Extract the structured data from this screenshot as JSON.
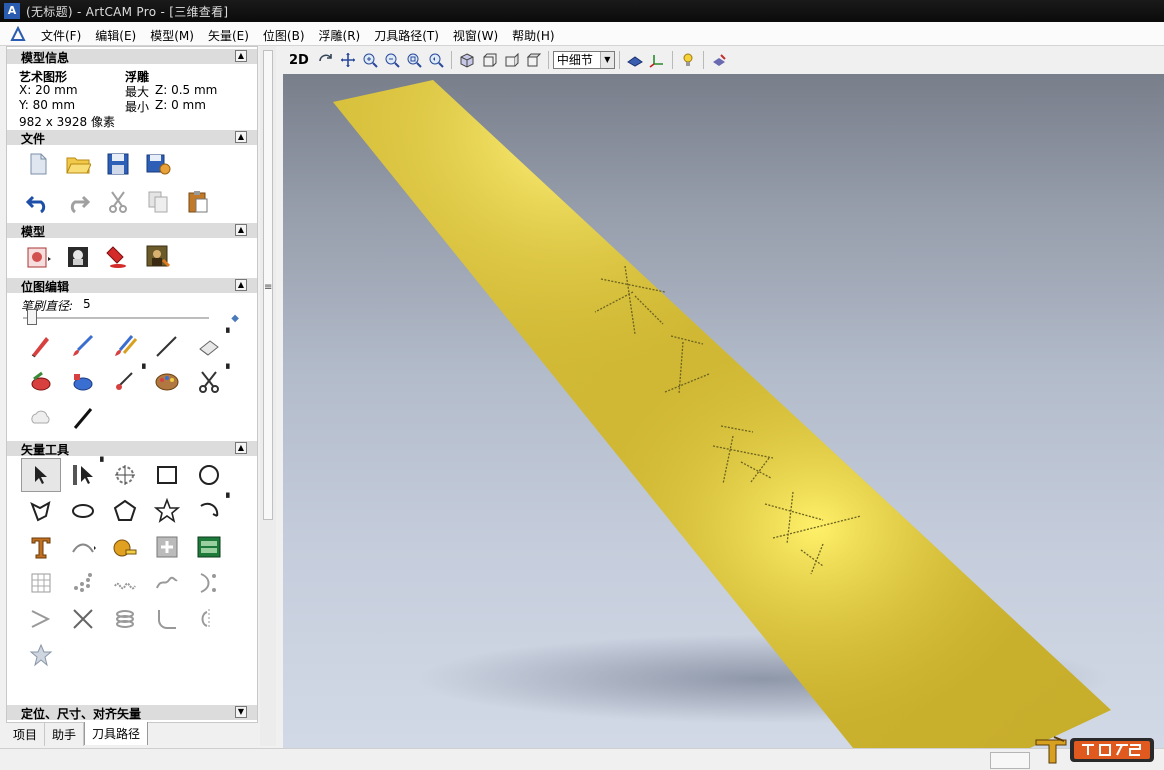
{
  "window": {
    "title": "(无标题) - ArtCAM Pro - [三维查看]"
  },
  "menu": {
    "items": [
      "文件(F)",
      "编辑(E)",
      "模型(M)",
      "矢量(E)",
      "位图(B)",
      "浮雕(R)",
      "刀具路径(T)",
      "视窗(W)",
      "帮助(H)"
    ]
  },
  "panel": {
    "model_info": {
      "header": "模型信息",
      "art_label": "艺术图形",
      "x_size": "X: 20 mm",
      "y_size": "Y: 80 mm",
      "pixels": "982 x 3928 像素",
      "relief_label": "浮雕",
      "max_label": "最大",
      "max_z": "Z: 0.5 mm",
      "min_label": "最小",
      "min_z": "Z: 0 mm"
    },
    "file_header": "文件",
    "model_header": "模型",
    "bitmap_header": "位图编辑",
    "brush": {
      "label": "笔刷直径:",
      "value": "5",
      "level": 0.05
    },
    "vector_header": "矢量工具",
    "align_header": "定位、尺寸、对齐矢量"
  },
  "bottom_tabs": [
    "项目",
    "助手",
    "刀具路径"
  ],
  "view_toolbar": {
    "mode_2d": "2D",
    "detail_select": "中细节"
  },
  "viewport": {
    "engraved_text": "木工爱好者",
    "relief_color": "#d9c23a",
    "background_top": "#787e8a",
    "background_bottom": "#d2d9e6"
  },
  "icons": {
    "file": [
      "new-file-icon",
      "open-folder-icon",
      "save-disk-icon",
      "save-as-icon",
      "undo-icon",
      "redo-icon",
      "cut-icon",
      "copy-icon",
      "paste-icon"
    ],
    "model": [
      "model-setup-icon",
      "model-image-icon",
      "paint-bucket-icon",
      "mona-lisa-icon"
    ]
  }
}
